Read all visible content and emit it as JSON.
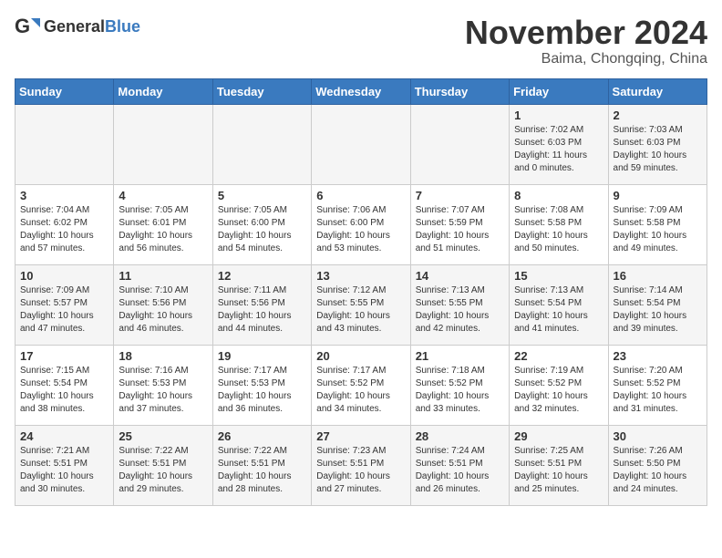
{
  "header": {
    "logo_general": "General",
    "logo_blue": "Blue",
    "title": "November 2024",
    "subtitle": "Baima, Chongqing, China"
  },
  "weekdays": [
    "Sunday",
    "Monday",
    "Tuesday",
    "Wednesday",
    "Thursday",
    "Friday",
    "Saturday"
  ],
  "weeks": [
    [
      {
        "day": "",
        "info": ""
      },
      {
        "day": "",
        "info": ""
      },
      {
        "day": "",
        "info": ""
      },
      {
        "day": "",
        "info": ""
      },
      {
        "day": "",
        "info": ""
      },
      {
        "day": "1",
        "info": "Sunrise: 7:02 AM\nSunset: 6:03 PM\nDaylight: 11 hours and 0 minutes."
      },
      {
        "day": "2",
        "info": "Sunrise: 7:03 AM\nSunset: 6:03 PM\nDaylight: 10 hours and 59 minutes."
      }
    ],
    [
      {
        "day": "3",
        "info": "Sunrise: 7:04 AM\nSunset: 6:02 PM\nDaylight: 10 hours and 57 minutes."
      },
      {
        "day": "4",
        "info": "Sunrise: 7:05 AM\nSunset: 6:01 PM\nDaylight: 10 hours and 56 minutes."
      },
      {
        "day": "5",
        "info": "Sunrise: 7:05 AM\nSunset: 6:00 PM\nDaylight: 10 hours and 54 minutes."
      },
      {
        "day": "6",
        "info": "Sunrise: 7:06 AM\nSunset: 6:00 PM\nDaylight: 10 hours and 53 minutes."
      },
      {
        "day": "7",
        "info": "Sunrise: 7:07 AM\nSunset: 5:59 PM\nDaylight: 10 hours and 51 minutes."
      },
      {
        "day": "8",
        "info": "Sunrise: 7:08 AM\nSunset: 5:58 PM\nDaylight: 10 hours and 50 minutes."
      },
      {
        "day": "9",
        "info": "Sunrise: 7:09 AM\nSunset: 5:58 PM\nDaylight: 10 hours and 49 minutes."
      }
    ],
    [
      {
        "day": "10",
        "info": "Sunrise: 7:09 AM\nSunset: 5:57 PM\nDaylight: 10 hours and 47 minutes."
      },
      {
        "day": "11",
        "info": "Sunrise: 7:10 AM\nSunset: 5:56 PM\nDaylight: 10 hours and 46 minutes."
      },
      {
        "day": "12",
        "info": "Sunrise: 7:11 AM\nSunset: 5:56 PM\nDaylight: 10 hours and 44 minutes."
      },
      {
        "day": "13",
        "info": "Sunrise: 7:12 AM\nSunset: 5:55 PM\nDaylight: 10 hours and 43 minutes."
      },
      {
        "day": "14",
        "info": "Sunrise: 7:13 AM\nSunset: 5:55 PM\nDaylight: 10 hours and 42 minutes."
      },
      {
        "day": "15",
        "info": "Sunrise: 7:13 AM\nSunset: 5:54 PM\nDaylight: 10 hours and 41 minutes."
      },
      {
        "day": "16",
        "info": "Sunrise: 7:14 AM\nSunset: 5:54 PM\nDaylight: 10 hours and 39 minutes."
      }
    ],
    [
      {
        "day": "17",
        "info": "Sunrise: 7:15 AM\nSunset: 5:54 PM\nDaylight: 10 hours and 38 minutes."
      },
      {
        "day": "18",
        "info": "Sunrise: 7:16 AM\nSunset: 5:53 PM\nDaylight: 10 hours and 37 minutes."
      },
      {
        "day": "19",
        "info": "Sunrise: 7:17 AM\nSunset: 5:53 PM\nDaylight: 10 hours and 36 minutes."
      },
      {
        "day": "20",
        "info": "Sunrise: 7:17 AM\nSunset: 5:52 PM\nDaylight: 10 hours and 34 minutes."
      },
      {
        "day": "21",
        "info": "Sunrise: 7:18 AM\nSunset: 5:52 PM\nDaylight: 10 hours and 33 minutes."
      },
      {
        "day": "22",
        "info": "Sunrise: 7:19 AM\nSunset: 5:52 PM\nDaylight: 10 hours and 32 minutes."
      },
      {
        "day": "23",
        "info": "Sunrise: 7:20 AM\nSunset: 5:52 PM\nDaylight: 10 hours and 31 minutes."
      }
    ],
    [
      {
        "day": "24",
        "info": "Sunrise: 7:21 AM\nSunset: 5:51 PM\nDaylight: 10 hours and 30 minutes."
      },
      {
        "day": "25",
        "info": "Sunrise: 7:22 AM\nSunset: 5:51 PM\nDaylight: 10 hours and 29 minutes."
      },
      {
        "day": "26",
        "info": "Sunrise: 7:22 AM\nSunset: 5:51 PM\nDaylight: 10 hours and 28 minutes."
      },
      {
        "day": "27",
        "info": "Sunrise: 7:23 AM\nSunset: 5:51 PM\nDaylight: 10 hours and 27 minutes."
      },
      {
        "day": "28",
        "info": "Sunrise: 7:24 AM\nSunset: 5:51 PM\nDaylight: 10 hours and 26 minutes."
      },
      {
        "day": "29",
        "info": "Sunrise: 7:25 AM\nSunset: 5:51 PM\nDaylight: 10 hours and 25 minutes."
      },
      {
        "day": "30",
        "info": "Sunrise: 7:26 AM\nSunset: 5:50 PM\nDaylight: 10 hours and 24 minutes."
      }
    ]
  ]
}
